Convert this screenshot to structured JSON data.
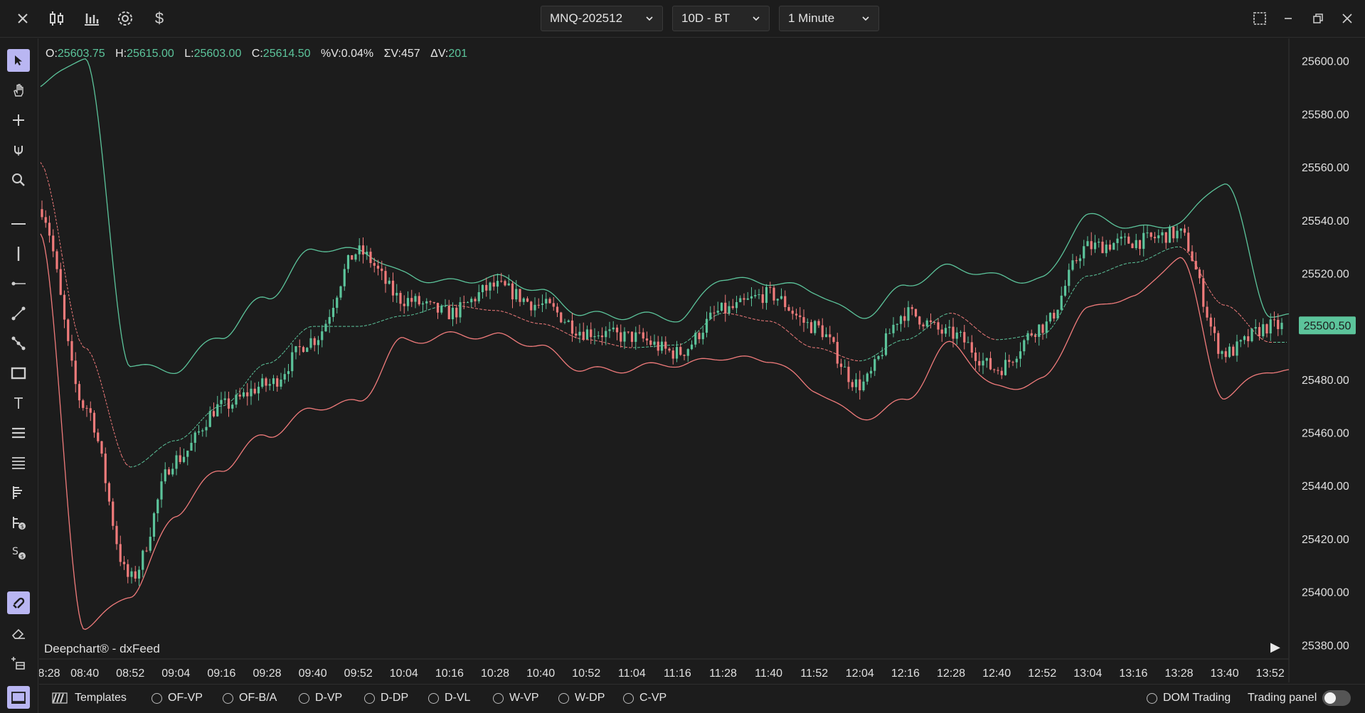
{
  "topbar": {
    "icons": [
      "close-icon",
      "candles-icon",
      "bars-icon",
      "gear-icon",
      "dollar-icon"
    ],
    "symbol": "MNQ-202512",
    "range": "10D - BT",
    "interval": "1 Minute"
  },
  "ohlc": {
    "o_label": "O:",
    "o": "25603.75",
    "h_label": "H:",
    "h": "25615.00",
    "l_label": "L:",
    "l": "25603.00",
    "c_label": "C:",
    "c": "25614.50",
    "pv_label": "%V:",
    "pv": "0.04%",
    "sv_label": "ΣV:",
    "sv": "457",
    "dv_label": "ΔV:",
    "dv": "201"
  },
  "price_axis": {
    "labels": [
      "25600.00",
      "25580.00",
      "25560.00",
      "25540.00",
      "25520.00",
      "25500.00",
      "25480.00",
      "25460.00",
      "25440.00",
      "25420.00",
      "25400.00",
      "25380.00"
    ],
    "current_price": "25500.50"
  },
  "time_axis": {
    "labels": [
      "8:28",
      "08:40",
      "08:52",
      "09:04",
      "09:16",
      "09:28",
      "09:40",
      "09:52",
      "10:04",
      "10:16",
      "10:28",
      "10:40",
      "10:52",
      "11:04",
      "11:16",
      "11:28",
      "11:40",
      "11:52",
      "12:04",
      "12:16",
      "12:28",
      "12:40",
      "12:52",
      "13:04",
      "13:16",
      "13:28",
      "13:40",
      "13:52"
    ]
  },
  "watermark": "Deepchart® - dxFeed",
  "bottombar": {
    "templates": "Templates",
    "radios": [
      "OF-VP",
      "OF-B/A",
      "D-VP",
      "D-DP",
      "D-VL",
      "W-VP",
      "W-DP",
      "C-VP"
    ],
    "dom_trading": "DOM Trading",
    "trading_panel": "Trading panel"
  },
  "colors": {
    "up": "#5cc49b",
    "down": "#f07b7b",
    "band_upper": "#5cc49b",
    "band_lower": "#f07b7b",
    "accent": "#b9b6f2",
    "price_tag": "#5cc49b"
  },
  "chart_data": {
    "type": "line",
    "title": "",
    "y_range": [
      25375,
      25605
    ],
    "x_categories": [
      "8:28",
      "08:40",
      "08:52",
      "09:04",
      "09:16",
      "09:28",
      "09:40",
      "09:52",
      "10:04",
      "10:16",
      "10:28",
      "10:40",
      "10:52",
      "11:04",
      "11:16",
      "11:28",
      "11:40",
      "11:52",
      "12:04",
      "12:16",
      "12:28",
      "12:40",
      "12:52",
      "13:04",
      "13:16",
      "13:28",
      "13:40",
      "13:52"
    ],
    "series": [
      {
        "name": "",
        "role": "price",
        "values": [
          25545,
          25470,
          25405,
          25450,
          25470,
          25478,
          25495,
          25528,
          25510,
          25505,
          25515,
          25508,
          25498,
          25496,
          25490,
          25506,
          25512,
          25500,
          25478,
          25505,
          25497,
          25484,
          25500,
          25530,
          25532,
          25535,
          25490,
          25500
        ]
      },
      {
        "name": "",
        "role": "upper-band",
        "values": [
          25590,
          25600,
          25487,
          25484,
          25495,
          25512,
          25530,
          25527,
          25520,
          25518,
          25517,
          25513,
          25506,
          25503,
          25502,
          25520,
          25516,
          25512,
          25505,
          25515,
          25521,
          25520,
          25518,
          25540,
          25538,
          25540,
          25553,
          25505
        ]
      },
      {
        "name": "",
        "role": "lower-band",
        "values": [
          25535,
          25385,
          25400,
          25430,
          25445,
          25460,
          25470,
          25470,
          25495,
          25498,
          25495,
          25492,
          25485,
          25483,
          25485,
          25490,
          25487,
          25475,
          25467,
          25472,
          25492,
          25478,
          25480,
          25505,
          25512,
          25527,
          25472,
          25484
        ]
      },
      {
        "name": "",
        "role": "mid-line",
        "values": [
          25562,
          25492,
          25447,
          25457,
          25470,
          25486,
          25500,
          25500,
          25504,
          25508,
          25506,
          25501,
          25495,
          25492,
          25493,
          25505,
          25502,
          25492,
          25487,
          25495,
          25505,
          25495,
          25497,
          25519,
          25524,
          25530,
          25508,
          25494
        ]
      }
    ]
  }
}
